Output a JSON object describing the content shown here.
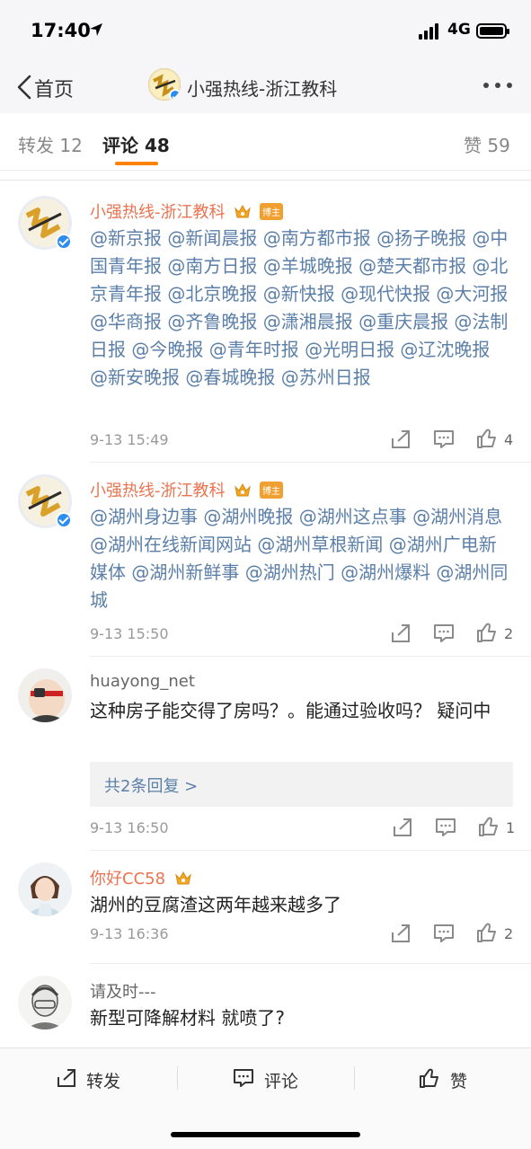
{
  "status": {
    "time": "17:40",
    "network": "4G"
  },
  "nav": {
    "back_label": "首页",
    "title": "小强热线-浙江教科"
  },
  "tabs": {
    "repost_label": "转发",
    "repost_count": "12",
    "comment_label": "评论",
    "comment_count": "48",
    "like_label": "赞",
    "like_count": "59"
  },
  "comments": [
    {
      "name": "小强热线-浙江教科",
      "badge": "博主",
      "text": "@新京报 @新闻晨报 @南方都市报 @扬子晚报 @中国青年报 @南方日报 @羊城晚报 @楚天都市报 @北京青年报 @北京晚报 @新快报 @现代快报 @大河报 @华商报 @齐鲁晚报 @潇湘晨报 @重庆晨报 @法制日报 @今晚报 @青年时报 @光明日报 @辽沈晚报 @新安晚报 @春城晚报 @苏州日报",
      "time": "9-13 15:49",
      "likes": "4"
    },
    {
      "name": "小强热线-浙江教科",
      "badge": "博主",
      "text": "@湖州身边事 @湖州晚报 @湖州这点事 @湖州消息 @湖州在线新闻网站 @湖州草根新闻 @湖州广电新媒体 @湖州新鲜事 @湖州热门 @湖州爆料 @湖州同城",
      "time": "9-13 15:50",
      "likes": "2"
    },
    {
      "name": "huayong_net",
      "text": "这种房子能交得了房吗？。能通过验收吗？ 疑问中",
      "replies": "共2条回复 >",
      "time": "9-13 16:50",
      "likes": "1"
    },
    {
      "name": "你好CC58",
      "text": "湖州的豆腐渣这两年越来越多了",
      "time": "9-13 16:36",
      "likes": "2"
    },
    {
      "name": "请及时---",
      "text": "新型可降解材料 就喷了?"
    }
  ],
  "bottom_bar": {
    "repost": "转发",
    "comment": "评论",
    "like": "赞"
  },
  "colors": {
    "accent": "#ff8200",
    "mention": "#5b7fa8",
    "name_orange": "#eb7350",
    "verified": "#2d8cf0"
  }
}
